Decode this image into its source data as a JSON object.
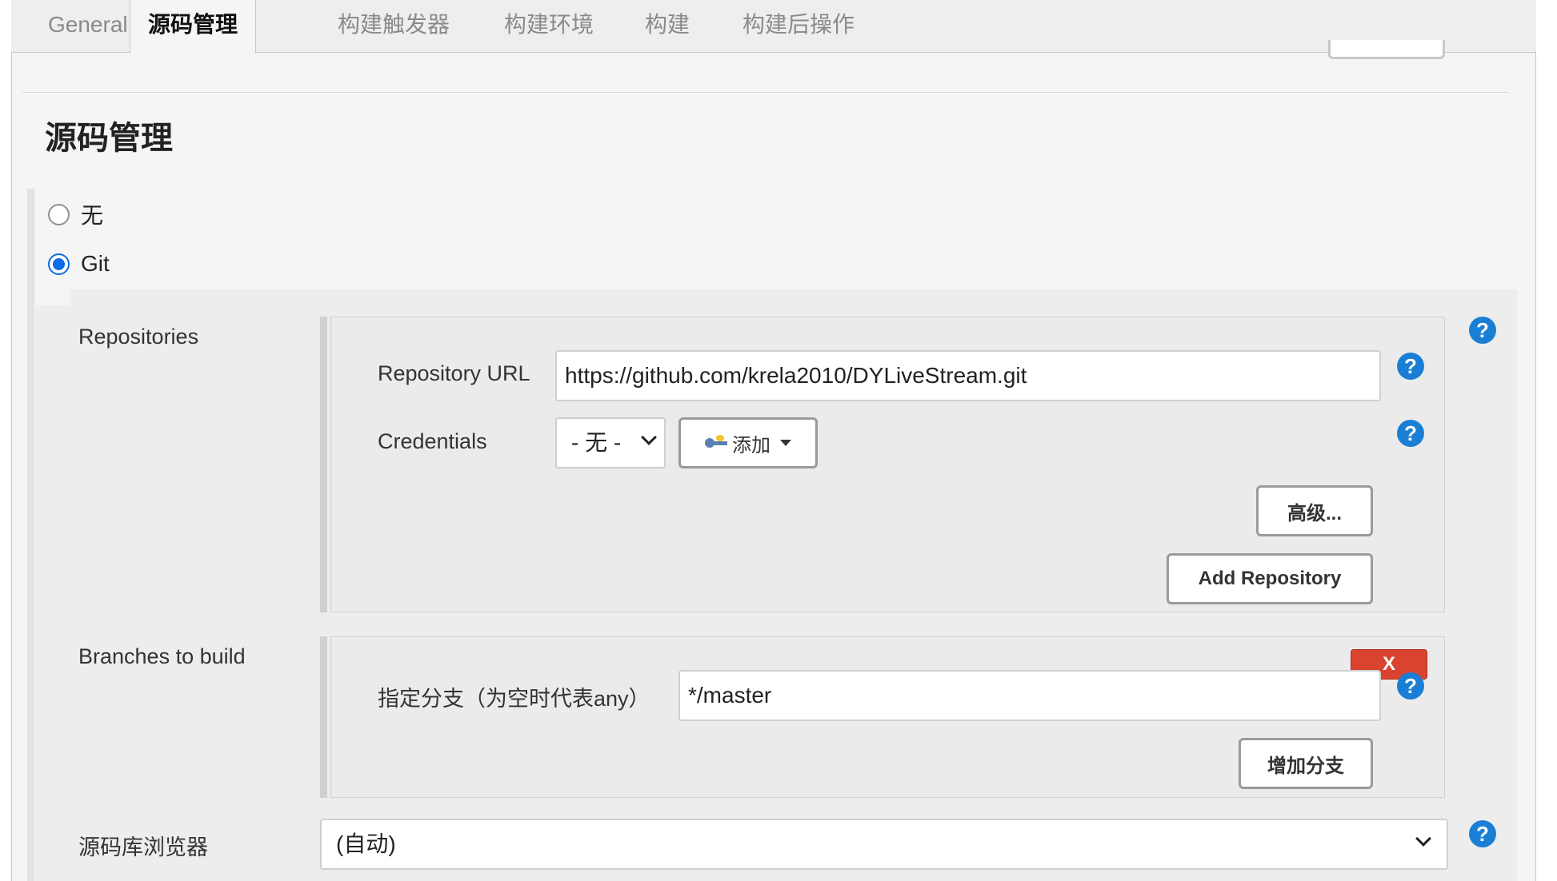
{
  "tabs": [
    {
      "label": "General",
      "active": false
    },
    {
      "label": "源码管理",
      "active": true
    },
    {
      "label": "构建触发器",
      "active": false
    },
    {
      "label": "构建环境",
      "active": false
    },
    {
      "label": "构建",
      "active": false
    },
    {
      "label": "构建后操作",
      "active": false
    }
  ],
  "section": {
    "title": "源码管理"
  },
  "scm_options": [
    {
      "label": "无",
      "selected": false
    },
    {
      "label": "Git",
      "selected": true
    }
  ],
  "repositories": {
    "label": "Repositories",
    "url_label": "Repository URL",
    "url_value": "https://github.com/krela2010/DYLiveStream.git",
    "credentials_label": "Credentials",
    "credentials_selected": "- 无 -",
    "add_label": "添加",
    "advanced_label": "高级...",
    "add_repository_label": "Add Repository"
  },
  "branches": {
    "label": "Branches to build",
    "specifier_label": "指定分支（为空时代表any）",
    "specifier_value": "*/master",
    "delete_label": "X",
    "add_branch_label": "增加分支"
  },
  "browser": {
    "label": "源码库浏览器",
    "selected": "(自动)"
  },
  "help_label": "?",
  "colors": {
    "accent": "#0b6be6",
    "help": "#1a7fd4",
    "delete": "#d9432f"
  }
}
